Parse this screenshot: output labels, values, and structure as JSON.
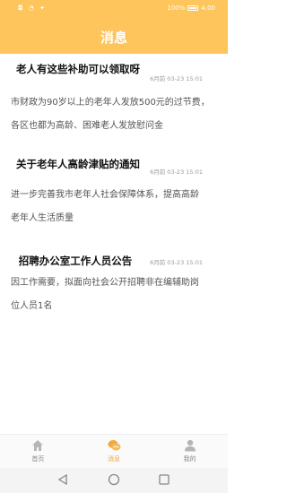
{
  "status": {
    "left": "◘ ◔ ✦",
    "battery": "100%",
    "time": "4:00"
  },
  "header": {
    "title": "消息"
  },
  "messages": [
    {
      "title": "老人有这些补助可以领取呀",
      "time": "6月前 03-23 15:01",
      "desc": [
        "市财政为90岁以上的老年人发放500元的过节费，",
        "各区也都为高龄、困难老人发放慰问金"
      ]
    },
    {
      "title": "关于老年人高龄津贴的通知",
      "time": "6月前 03-23 15:01",
      "desc": [
        "进一步完善我市老年人社会保障体系，提高高龄",
        "老年人生活质量"
      ]
    },
    {
      "title": "招聘办公室工作人员公告",
      "time": "6月前 03-23 15:01",
      "desc": [
        "因工作需要，拟面向社会公开招聘非在编辅助岗",
        "位人员1名"
      ]
    }
  ],
  "tabs": [
    {
      "label": "首页",
      "icon": "home-icon",
      "active": false
    },
    {
      "label": "消息",
      "icon": "chat-icon",
      "active": true
    },
    {
      "label": "我的",
      "icon": "user-icon",
      "active": false
    }
  ],
  "colors": {
    "accent": "#fdc55c",
    "tab_active": "#f2a73a"
  }
}
